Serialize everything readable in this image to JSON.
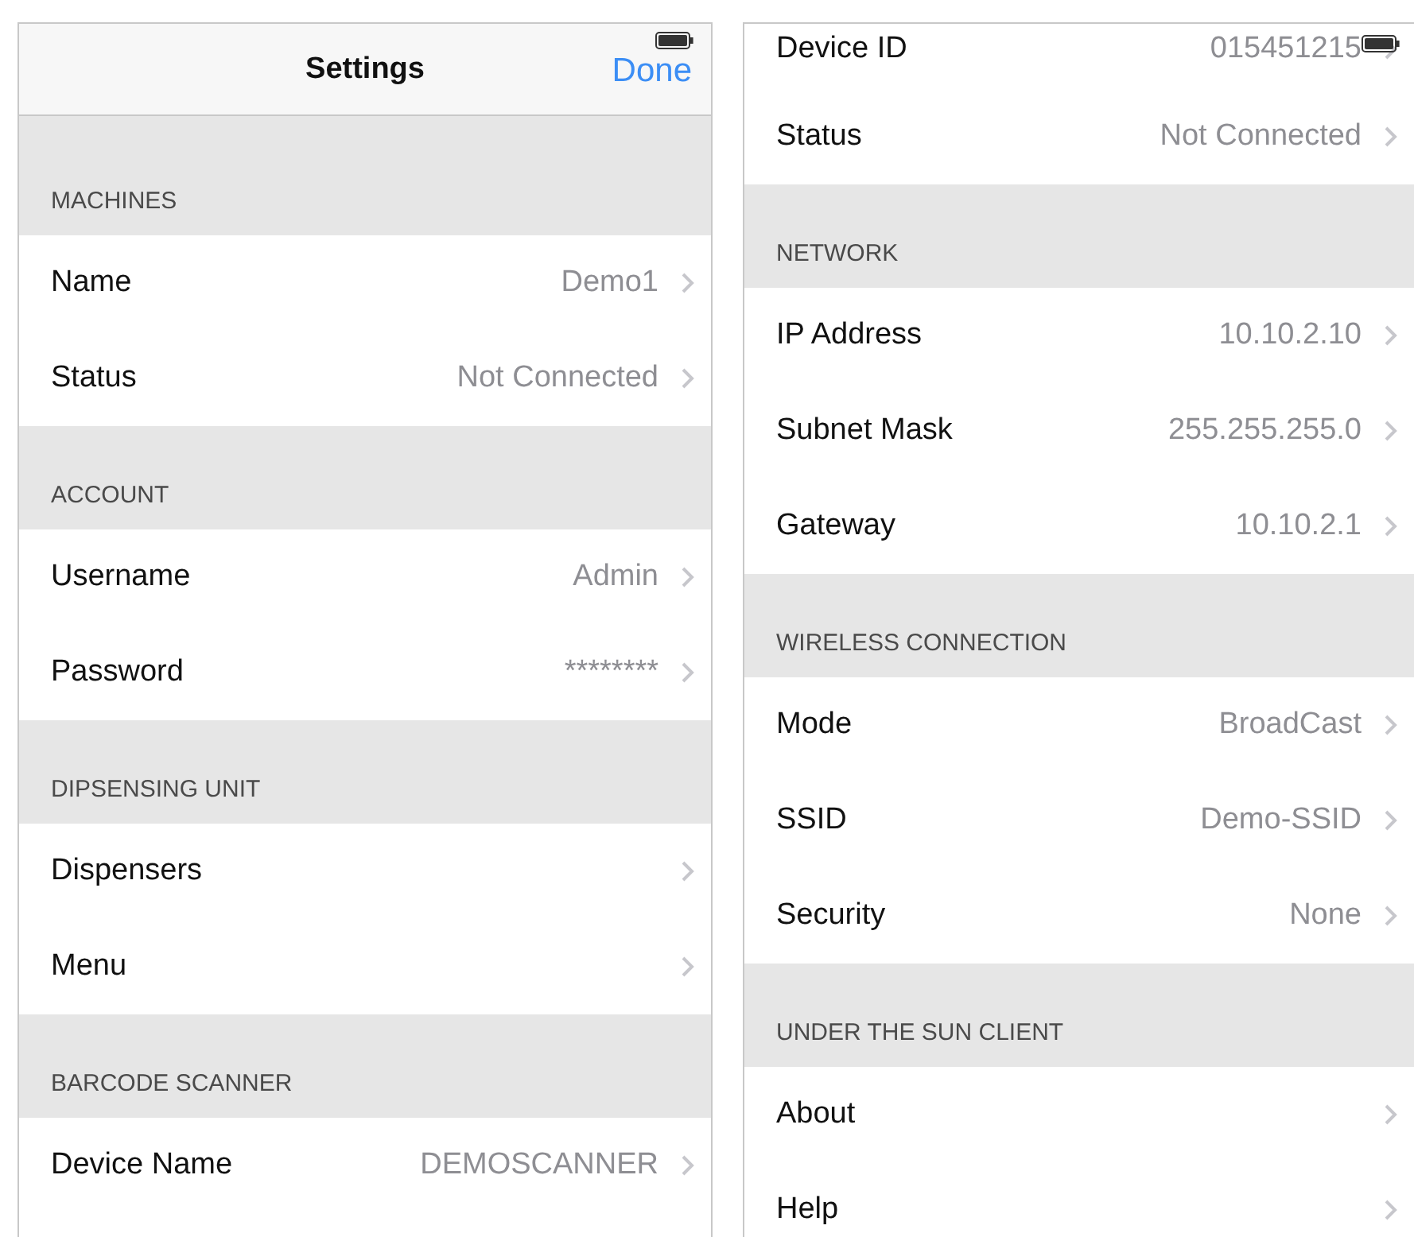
{
  "left_screen": {
    "nav_bar": {
      "title": "Settings",
      "done_button": "Done"
    },
    "sections": [
      {
        "header": "MACHINES",
        "rows": [
          {
            "label": "Name",
            "value": "Demo1"
          },
          {
            "label": "Status",
            "value": "Not Connected"
          }
        ]
      },
      {
        "header": "ACCOUNT",
        "rows": [
          {
            "label": "Username",
            "value": "Admin"
          },
          {
            "label": "Password",
            "value": "********"
          }
        ]
      },
      {
        "header": "DIPSENSING UNIT",
        "rows": [
          {
            "label": "Dispensers"
          },
          {
            "label": "Menu"
          }
        ]
      },
      {
        "header": "BARCODE SCANNER",
        "rows": [
          {
            "label": "Device Name",
            "value": "DEMOSCANNER"
          }
        ]
      }
    ]
  },
  "right_screen": {
    "sections": [
      {
        "rows": [
          {
            "label": "Device ID",
            "value": "015451215"
          },
          {
            "label": "Status",
            "value": "Not Connected"
          }
        ]
      },
      {
        "header": "NETWORK",
        "rows": [
          {
            "label": "IP Address",
            "value": "10.10.2.10"
          },
          {
            "label": "Subnet Mask",
            "value": "255.255.255.0"
          },
          {
            "label": "Gateway",
            "value": "10.10.2.1"
          }
        ]
      },
      {
        "header": "WIRELESS CONNECTION",
        "rows": [
          {
            "label": "Mode",
            "value": "BroadCast"
          },
          {
            "label": "SSID",
            "value": "Demo-SSID"
          },
          {
            "label": "Security",
            "value": "None"
          }
        ]
      },
      {
        "header": "UNDER THE SUN CLIENT",
        "rows": [
          {
            "label": "About"
          },
          {
            "label": "Help"
          }
        ]
      }
    ]
  }
}
